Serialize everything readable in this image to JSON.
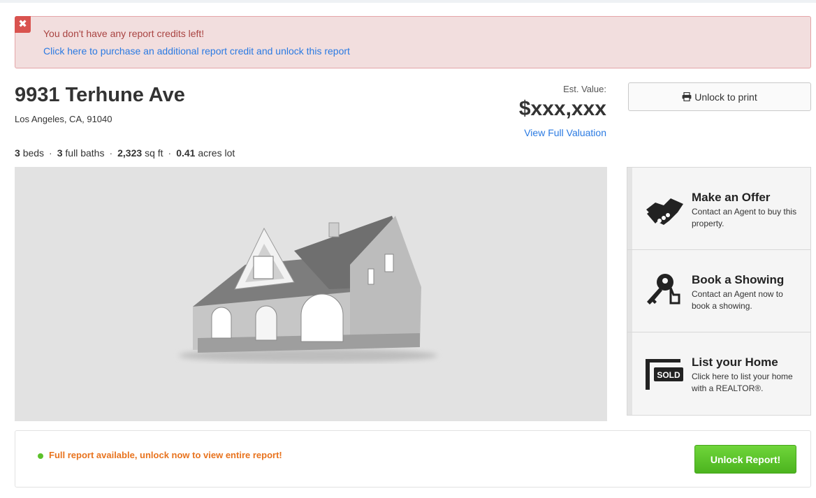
{
  "alert": {
    "close_glyph": "✖",
    "message": "You don't have any report credits left!",
    "link": "Click here to purchase an additional report credit and unlock this report"
  },
  "property": {
    "street": "9931 Terhune Ave",
    "city_line": "Los Angeles, CA, 91040",
    "beds_value": "3",
    "beds_unit": "beds",
    "baths_value": "3",
    "baths_unit": "full baths",
    "sqft_value": "2,323",
    "sqft_unit": "sq ft",
    "lot_value": "0.41",
    "lot_unit": "acres lot",
    "separator": "·"
  },
  "valuation": {
    "label": "Est. Value:",
    "value": "$xxx,xxx",
    "link": "View Full Valuation"
  },
  "print_button": {
    "label": "Unlock to print",
    "icon": "printer-icon"
  },
  "actions": [
    {
      "title": "Make an Offer",
      "description": "Contact an Agent to buy this property.",
      "icon": "handshake-icon"
    },
    {
      "title": "Book a Showing",
      "description": "Contact an Agent now to book a showing.",
      "icon": "keys-icon"
    },
    {
      "title": "List your Home",
      "description": "Click here to list your home with a REALTOR®.",
      "icon": "sold-sign-icon",
      "sign_text": "SOLD"
    }
  ],
  "bottom": {
    "message": "Full report available, unlock now to view entire report!",
    "button": "Unlock Report!"
  },
  "colors": {
    "alert_bg": "#f2dede",
    "alert_text": "#a94442",
    "link": "#2a7ae2",
    "cta_green": "#5cc12b",
    "notice_orange": "#e8731e"
  }
}
